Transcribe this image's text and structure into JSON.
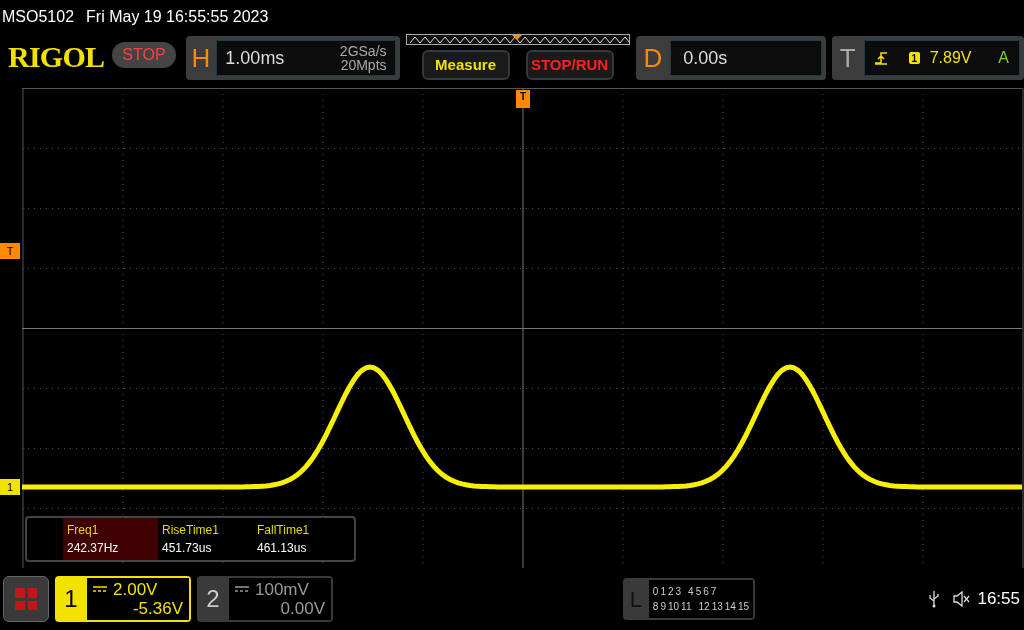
{
  "status_line": {
    "model": "MSO5102",
    "datetime": "Fri May 19 16:55:55 2023"
  },
  "top_bar": {
    "logo": "RIGOL",
    "run_state": "STOP",
    "horizontal": {
      "letter": "H",
      "timebase": "1.00ms",
      "sample_rate": "2GSa/s",
      "memory_depth": "20Mpts"
    },
    "buttons": [
      "Measure",
      "STOP/RUN"
    ],
    "delay": {
      "letter": "D",
      "value": "0.00s"
    },
    "trigger": {
      "letter": "T",
      "channel": "1",
      "level": "7.89V",
      "mode": "A"
    }
  },
  "screen": {
    "trigger_position_marker": "T",
    "trigger_level_marker": "T",
    "channel_marker": "1"
  },
  "measurements": [
    {
      "name": "Freq1",
      "value": "242.37Hz",
      "selected": true
    },
    {
      "name": "RiseTime1",
      "value": "451.73us",
      "selected": false
    },
    {
      "name": "FallTime1",
      "value": "461.13us",
      "selected": false
    }
  ],
  "channels": [
    {
      "number": "1",
      "scale": "2.00V",
      "offset": "-5.36V",
      "selected": true
    },
    {
      "number": "2",
      "scale": "100mV",
      "offset": "0.00V",
      "selected": false
    }
  ],
  "logic": {
    "letter": "L",
    "row_1": [
      "0",
      "1",
      "2",
      "3",
      "4",
      "5",
      "6",
      "7"
    ],
    "row_2": [
      "8",
      "9",
      "10",
      "11",
      "12",
      "13",
      "14",
      "15"
    ]
  },
  "clock": "16:55"
}
